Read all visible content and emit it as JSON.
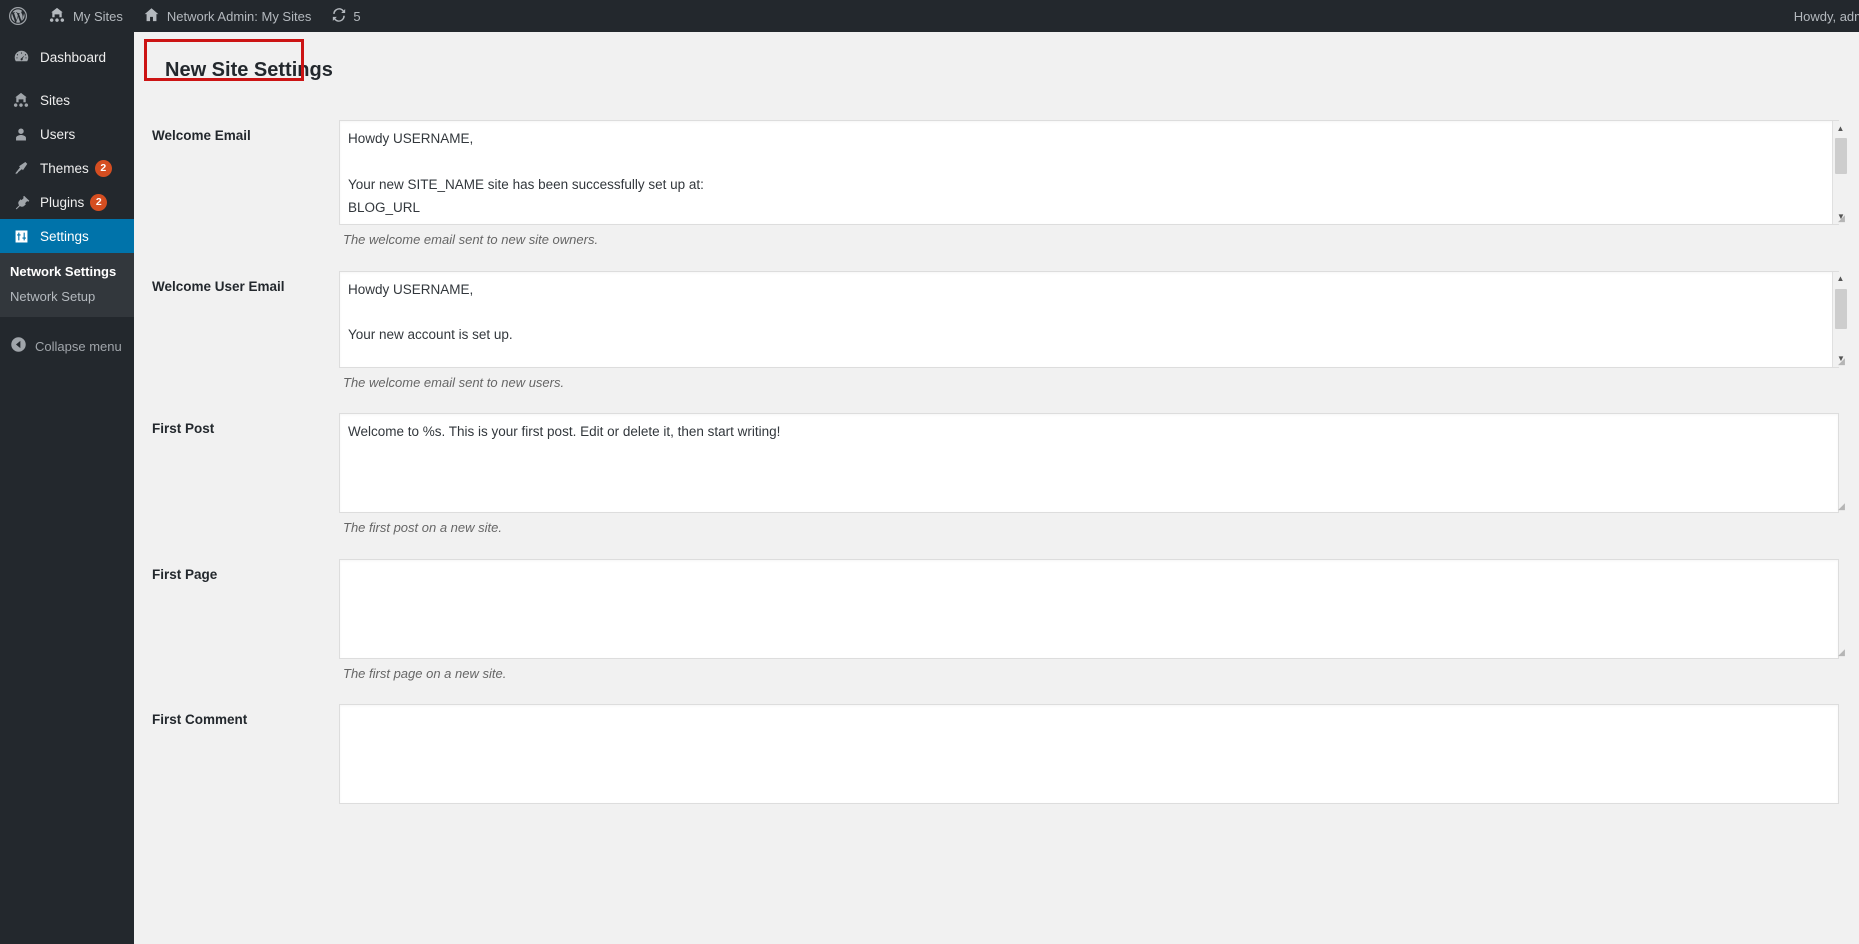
{
  "adminbar": {
    "logo_icon": "wordpress-logo-icon",
    "my_sites_icon": "sites-multisite-icon",
    "my_sites_label": "My Sites",
    "network_admin_icon": "home-icon",
    "network_admin_label": "Network Admin: My Sites",
    "updates_icon": "update-arrows-icon",
    "updates_count": "5",
    "howdy_label": "Howdy, adm"
  },
  "sidebar": {
    "items": [
      {
        "label": "Dashboard",
        "icon": "dashboard-icon",
        "badge": "",
        "current": false
      },
      {
        "label": "Sites",
        "icon": "sites-icon",
        "badge": "",
        "current": false
      },
      {
        "label": "Users",
        "icon": "users-icon",
        "badge": "",
        "current": false
      },
      {
        "label": "Themes",
        "icon": "themes-brush-icon",
        "badge": "2",
        "current": false
      },
      {
        "label": "Plugins",
        "icon": "plugins-plug-icon",
        "badge": "2",
        "current": false
      },
      {
        "label": "Settings",
        "icon": "settings-sliders-icon",
        "badge": "",
        "current": true
      }
    ],
    "submenu": [
      {
        "label": "Network Settings",
        "current": true
      },
      {
        "label": "Network Setup",
        "current": false
      }
    ],
    "collapse_label": "Collapse menu",
    "collapse_icon": "collapse-left-arrow-icon",
    "active_color": "#0073aa",
    "badge_color": "#d54e21"
  },
  "page": {
    "title": "New Site Settings",
    "annotation_color": "#cc1414"
  },
  "fields": [
    {
      "label": "Welcome Email",
      "name": "welcome-email",
      "value": "Howdy USERNAME,\n\nYour new SITE_NAME site has been successfully set up at:\nBLOG_URL\n\nYou can log in to the administrator account with the following information:",
      "description": "The welcome email sent to new site owners.",
      "scrollable": true
    },
    {
      "label": "Welcome User Email",
      "name": "welcome-user-email",
      "value": "Howdy USERNAME,\n\nYour new account is set up.\n\nYou can log in with the following information:\nUsername: USERNAME",
      "description": "The welcome email sent to new users.",
      "scrollable": true
    },
    {
      "label": "First Post",
      "name": "first-post",
      "value": "Welcome to %s. This is your first post. Edit or delete it, then start writing!",
      "description": "The first post on a new site.",
      "scrollable": false
    },
    {
      "label": "First Page",
      "name": "first-page",
      "value": "",
      "description": "The first page on a new site.",
      "scrollable": false
    },
    {
      "label": "First Comment",
      "name": "first-comment",
      "value": "",
      "description": "",
      "scrollable": false
    }
  ]
}
